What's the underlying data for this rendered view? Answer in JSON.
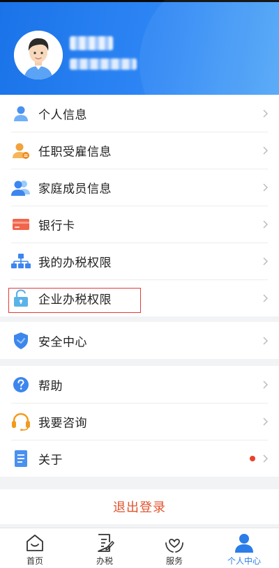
{
  "profile": {
    "name_masked": "",
    "phone_masked": ""
  },
  "groups": [
    {
      "items": [
        {
          "label": "个人信息",
          "icon": "person-icon"
        },
        {
          "label": "任职受雇信息",
          "icon": "employee-icon"
        },
        {
          "label": "家庭成员信息",
          "icon": "family-icon"
        },
        {
          "label": "银行卡",
          "icon": "bank-card-icon"
        },
        {
          "label": "我的办税权限",
          "icon": "hierarchy-icon"
        },
        {
          "label": "企业办税权限",
          "icon": "unlock-icon"
        }
      ]
    },
    {
      "items": [
        {
          "label": "安全中心",
          "icon": "shield-check-icon"
        }
      ]
    },
    {
      "items": [
        {
          "label": "帮助",
          "icon": "help-icon"
        },
        {
          "label": "我要咨询",
          "icon": "headset-icon"
        },
        {
          "label": "关于",
          "icon": "document-icon",
          "has_dot": true
        }
      ]
    }
  ],
  "logout_label": "退出登录",
  "tabs": [
    {
      "label": "首页",
      "icon": "home-icon"
    },
    {
      "label": "办税",
      "icon": "tax-form-icon"
    },
    {
      "label": "服务",
      "icon": "service-heart-icon"
    },
    {
      "label": "个人中心",
      "icon": "user-center-icon",
      "active": true
    }
  ],
  "colors": {
    "header_blue": "#1a73e8",
    "accent_blue": "#2b7de9",
    "logout_red": "#e0532e",
    "highlight_red": "#e33a3a",
    "badge_red": "#e8412c"
  }
}
